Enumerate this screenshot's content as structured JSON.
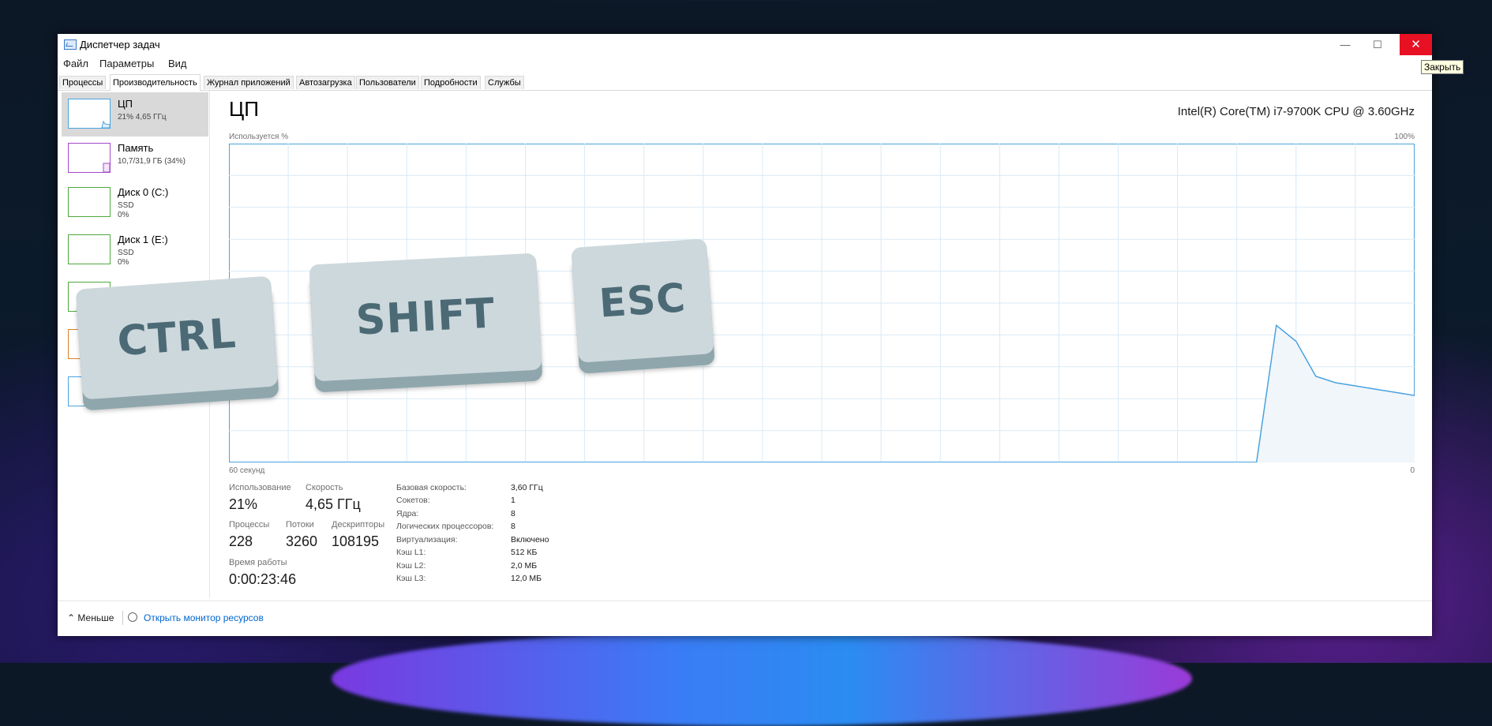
{
  "window": {
    "title": "Диспетчер задач",
    "controls": {
      "minimize": "—",
      "maximize": "☐",
      "close": "✕"
    },
    "close_tooltip": "Закрыть"
  },
  "menu": [
    "Файл",
    "Параметры",
    "Вид"
  ],
  "tabs": [
    "Процессы",
    "Производительность",
    "Журнал приложений",
    "Автозагрузка",
    "Пользователи",
    "Подробности",
    "Службы"
  ],
  "active_tab": "Производительность",
  "sidebar": {
    "items": [
      {
        "name": "ЦП",
        "sub": "21% 4,65 ГГц",
        "sub2": "",
        "color": "#4aa3df"
      },
      {
        "name": "Память",
        "sub": "10,7/31,9 ГБ (34%)",
        "sub2": "",
        "color": "#a349c9"
      },
      {
        "name": "Диск 0 (C:)",
        "sub": "SSD",
        "sub2": "0%",
        "color": "#4fa83d"
      },
      {
        "name": "Диск 1 (E:)",
        "sub": "SSD",
        "sub2": "0%",
        "color": "#4fa83d"
      },
      {
        "name": "",
        "sub": "",
        "sub2": "",
        "color": "#4fa83d"
      },
      {
        "name": "",
        "sub": "",
        "sub2": "",
        "color": "#d9822b"
      },
      {
        "name": "",
        "sub": "",
        "sub2": "",
        "color": "#4aa3df"
      }
    ]
  },
  "main": {
    "title": "ЦП",
    "cpu_model": "Intel(R) Core(TM) i7-9700K CPU @ 3.60GHz",
    "graph": {
      "y_label": "Используется %",
      "y_max_label": "100%",
      "x_label": "60 секунд",
      "x_end_label": "0",
      "line_color": "#4aa3df",
      "fill_color": "#f1f6fb",
      "grid_color": "#d9eaf5"
    },
    "stats": {
      "usage_label": "Использование",
      "usage_value": "21%",
      "speed_label": "Скорость",
      "speed_value": "4,65 ГГц",
      "processes_label": "Процессы",
      "processes_value": "228",
      "threads_label": "Потоки",
      "threads_value": "3260",
      "handles_label": "Дескрипторы",
      "handles_value": "108195",
      "uptime_label": "Время работы",
      "uptime_value": "0:00:23:46"
    },
    "info": [
      {
        "key": "Базовая скорость:",
        "value": "3,60 ГГц"
      },
      {
        "key": "Сокетов:",
        "value": "1"
      },
      {
        "key": "Ядра:",
        "value": "8"
      },
      {
        "key": "Логических процессоров:",
        "value": "8"
      },
      {
        "key": "Виртуализация:",
        "value": "Включено"
      },
      {
        "key": "Кэш L1:",
        "value": "512 КБ"
      },
      {
        "key": "Кэш L2:",
        "value": "2,0 МБ"
      },
      {
        "key": "Кэш L3:",
        "value": "12,0 МБ"
      }
    ]
  },
  "footer": {
    "less_label": "Меньше",
    "monitor_link": "Открыть монитор ресурсов"
  },
  "overlay_keys": [
    "CTRL",
    "SHIFT",
    "ESC"
  ],
  "chart_data": {
    "type": "area",
    "ylabel": "Используется %",
    "ylim": [
      0,
      100
    ],
    "xlabel": "60 секунд",
    "x_tick_labels": [
      "60 секунд",
      "0"
    ],
    "grid": true,
    "x": [
      60,
      48,
      47,
      46,
      45,
      44,
      43,
      42,
      41,
      40,
      39,
      38,
      37,
      36,
      35,
      34,
      33,
      32,
      31,
      30,
      29,
      28,
      27,
      26,
      25,
      24,
      23,
      22,
      21,
      20,
      19,
      18,
      17,
      16,
      15,
      14,
      13,
      12,
      11,
      10,
      9,
      8,
      7,
      6,
      5,
      4,
      3,
      2,
      1,
      0
    ],
    "series": [
      {
        "values": [
          0,
          0,
          0,
          0,
          0,
          0,
          0,
          0,
          0,
          0,
          0,
          0,
          0,
          0,
          0,
          0,
          0,
          0,
          0,
          0,
          0,
          0,
          0,
          0,
          0,
          0,
          0,
          0,
          0,
          0,
          0,
          0,
          0,
          0,
          0,
          0,
          0,
          0,
          0,
          0,
          0,
          0,
          43,
          38,
          27,
          25,
          24,
          23,
          22,
          21
        ]
      }
    ]
  }
}
